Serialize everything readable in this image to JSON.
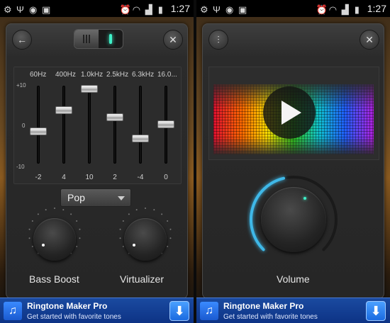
{
  "status_bar": {
    "time": "1:27"
  },
  "equalizer": {
    "bands": [
      {
        "freq": "60Hz",
        "gain": "-2",
        "level": -2
      },
      {
        "freq": "400Hz",
        "gain": "4",
        "level": 4
      },
      {
        "freq": "1.0kHz",
        "gain": "10",
        "level": 10
      },
      {
        "freq": "2.5kHz",
        "gain": "2",
        "level": 2
      },
      {
        "freq": "6.3kHz",
        "gain": "-4",
        "level": -4
      },
      {
        "freq": "16.0...",
        "gain": "0",
        "level": 0
      }
    ],
    "scale_top": "+10",
    "scale_mid": "0",
    "scale_bottom": "-10",
    "preset": "Pop"
  },
  "effects": {
    "bass_boost_label": "Bass Boost",
    "virtualizer_label": "Virtualizer",
    "volume_label": "Volume",
    "volume_level": 0.45
  },
  "ad": {
    "title": "Ringtone Maker Pro",
    "subtitle": "Get started with favorite tones"
  },
  "colors": {
    "accent": "#3ff0c8",
    "volume_ring": "#3fb8e8",
    "ad_bg": "#0d3385"
  }
}
